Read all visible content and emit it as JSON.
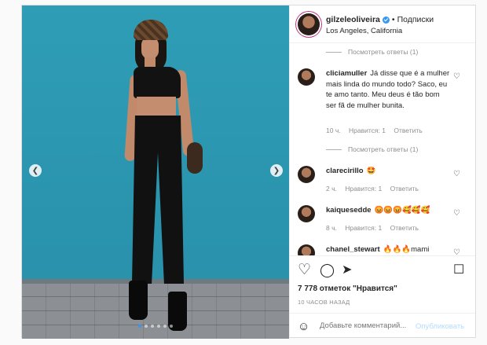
{
  "header": {
    "username": "gilzeleoliveira",
    "separator": "•",
    "follow_label": "Подписки",
    "location": "Los Angeles, California"
  },
  "comments": [
    {
      "type": "replies",
      "label": "Посмотреть ответы (1)"
    },
    {
      "type": "comment",
      "user": "cliciamuller",
      "text": "Já disse que é a mulher mais linda do mundo todo? Saco, eu te amo tanto. Meu deus é tão bom ser fã de mulher bunita.",
      "time": "10 ч.",
      "likes": "Нравится: 1",
      "reply": "Ответить"
    },
    {
      "type": "replies",
      "label": "Посмотреть ответы (1)"
    },
    {
      "type": "comment",
      "user": "clarecirillo",
      "text": "🤩",
      "time": "2 ч.",
      "likes": "Нравится: 1",
      "reply": "Ответить"
    },
    {
      "type": "comment",
      "user": "kaiquesedde",
      "text": "😡😡😡🥰🥰🥰",
      "time": "8 ч.",
      "likes": "Нравится: 1",
      "reply": "Ответить"
    },
    {
      "type": "comment",
      "user": "chanel_stewart",
      "text": "🔥🔥🔥mami"
    }
  ],
  "post": {
    "likes": "7 778 отметок \"Нравится\"",
    "time_ago": "10 ЧАСОВ НАЗАД",
    "add_comment_placeholder": "Добавьте комментарий...",
    "publish_label": "Опубликовать"
  },
  "carousel": {
    "slides": 6,
    "active_slide": 1
  },
  "colors": {
    "accent": "#3897f0",
    "wall": "#2f9db6",
    "publish_disabled": "#b3dbff"
  },
  "icons": [
    "heart-icon",
    "comment-icon",
    "share-icon",
    "bookmark-icon",
    "emoji-icon",
    "chevron-left-icon",
    "chevron-right-icon",
    "verified-icon"
  ]
}
